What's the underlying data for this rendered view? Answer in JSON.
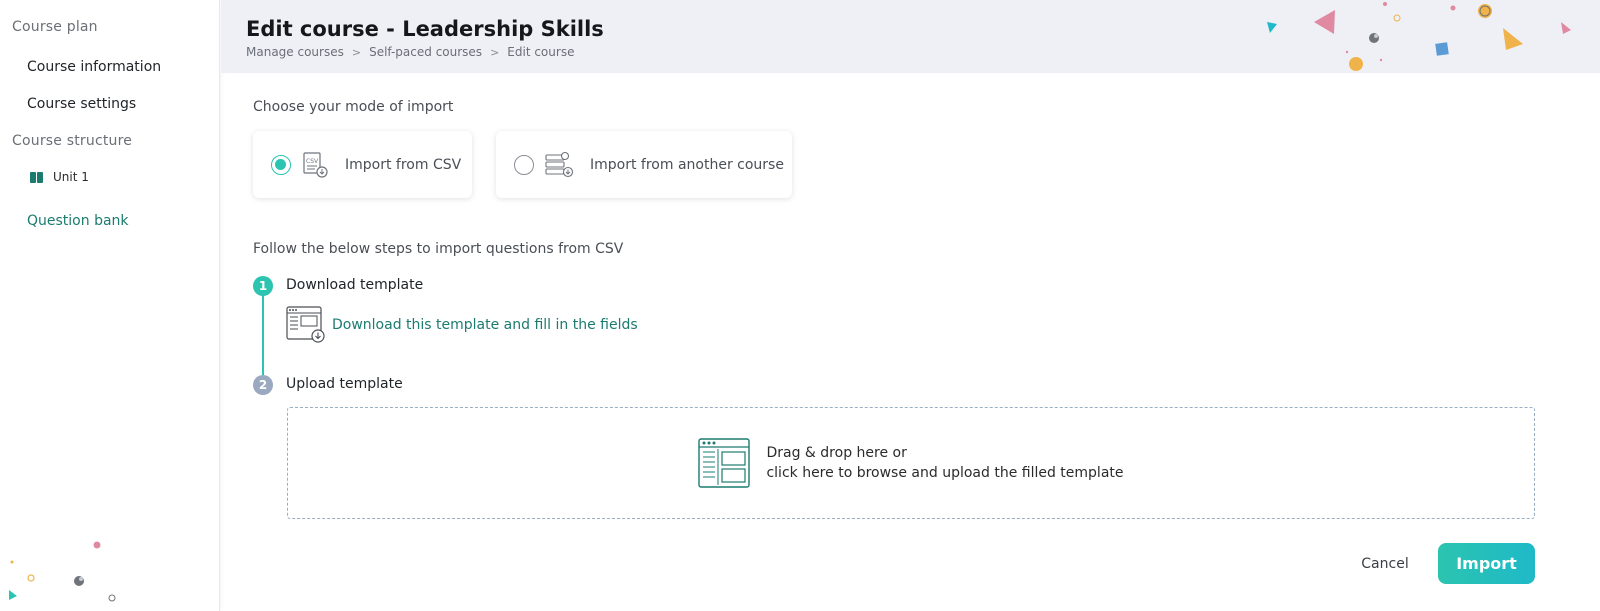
{
  "sidebar": {
    "course_plan_heading": "Course plan",
    "course_information": "Course information",
    "course_settings": "Course settings",
    "course_structure_heading": "Course structure",
    "unit_label": "Unit 1",
    "question_bank": "Question bank"
  },
  "header": {
    "title": "Edit course - Leadership Skills",
    "breadcrumb": [
      "Manage courses",
      "Self-paced courses",
      "Edit course"
    ],
    "breadcrumb_separator": ">"
  },
  "import": {
    "mode_label": "Choose your mode of import",
    "modes": [
      {
        "label": "Import from CSV",
        "selected": true,
        "icon": "csv-file-icon"
      },
      {
        "label": "Import from another course",
        "selected": false,
        "icon": "course-stack-icon"
      }
    ],
    "steps_label": "Follow the below steps to import questions from CSV",
    "steps": [
      {
        "number": "1",
        "title": "Download template",
        "link": "Download this template and fill in the fields"
      },
      {
        "number": "2",
        "title": "Upload template"
      }
    ],
    "dropzone_line1": "Drag & drop here or",
    "dropzone_line2": "click here to browse and upload the filled template"
  },
  "actions": {
    "cancel": "Cancel",
    "import": "Import"
  },
  "colors": {
    "accent": "#2bc4b0",
    "link": "#1b7b6f",
    "header_bg": "#eef0f6"
  }
}
